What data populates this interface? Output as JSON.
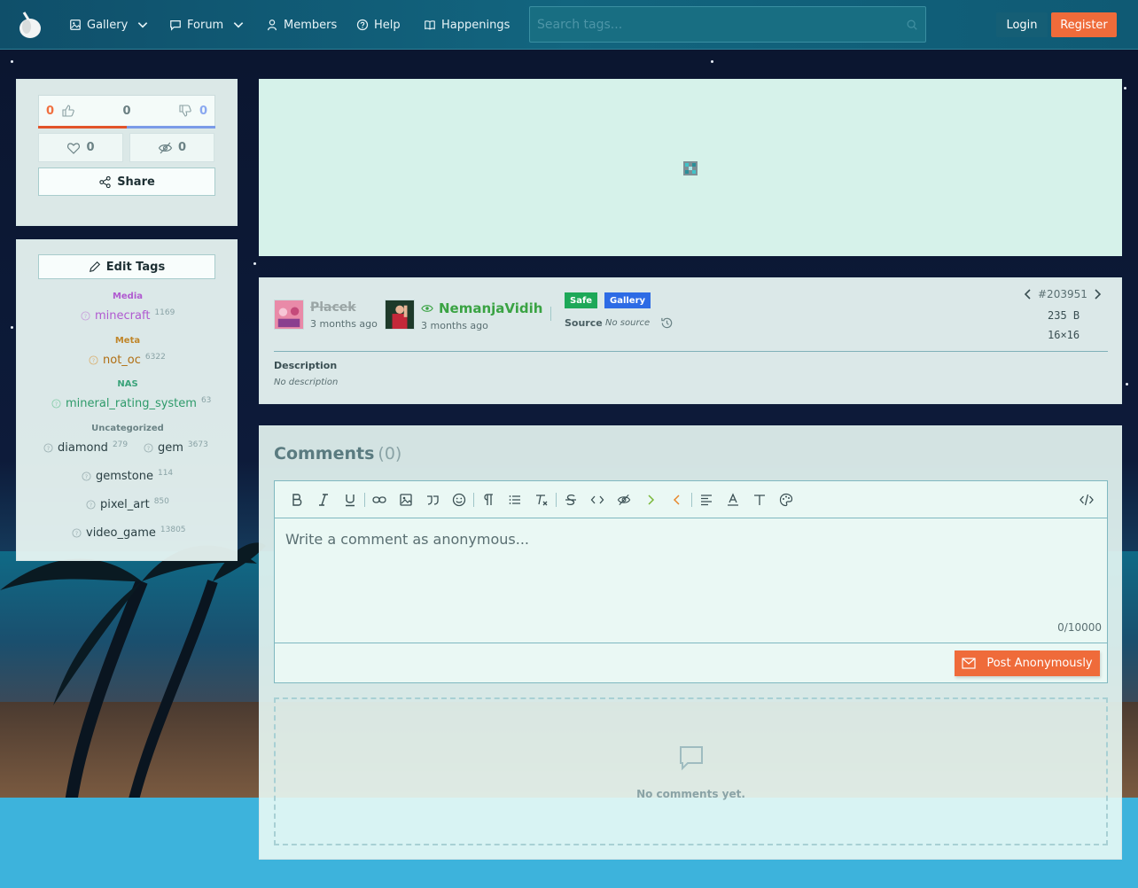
{
  "nav": {
    "items": [
      {
        "label": "Gallery",
        "icon": "image-icon",
        "dropdown": true
      },
      {
        "label": "Forum",
        "icon": "chat-icon",
        "dropdown": true
      },
      {
        "label": "Members",
        "icon": "user-icon",
        "dropdown": false
      },
      {
        "label": "Help",
        "icon": "help-icon",
        "dropdown": false
      },
      {
        "label": "Happenings",
        "icon": "book-icon",
        "dropdown": false
      }
    ],
    "search_placeholder": "Search tags...",
    "login_label": "Login",
    "register_label": "Register"
  },
  "votes": {
    "up": "0",
    "score": "0",
    "down": "0",
    "favorites": "0",
    "hides": "0",
    "share_label": "Share"
  },
  "tags": {
    "edit_label": "Edit Tags",
    "categories": [
      {
        "name": "Media",
        "color": "#b05ad0",
        "items": [
          {
            "name": "minecraft",
            "count": "1169"
          }
        ]
      },
      {
        "name": "Meta",
        "color": "#c0862a",
        "items": [
          {
            "name": "not_oc",
            "count": "6322"
          }
        ]
      },
      {
        "name": "NAS",
        "color": "#3aa37a",
        "items": [
          {
            "name": "mineral_rating_system",
            "count": "63"
          }
        ]
      },
      {
        "name": "Uncategorized",
        "color": "#6a8285",
        "items": [
          {
            "name": "diamond",
            "count": "279"
          },
          {
            "name": "gem",
            "count": "3673"
          },
          {
            "name": "gemstone",
            "count": "114"
          },
          {
            "name": "pixel_art",
            "count": "850"
          },
          {
            "name": "video_game",
            "count": "13805"
          }
        ]
      }
    ]
  },
  "info": {
    "uploader_name": "Placek",
    "uploader_time": "3 months ago",
    "approver_name": "NemanjaVidih",
    "approver_time": "3 months ago",
    "rating_badge": "Safe",
    "gallery_badge": "Gallery",
    "source_label": "Source",
    "source_value": "No source",
    "post_id": "#203951",
    "size": "235 B",
    "dimensions": "16×16",
    "description_label": "Description",
    "description_value": "No description"
  },
  "comments": {
    "title": "Comments",
    "count": "(0)",
    "placeholder": "Write a comment as anonymous...",
    "char_count": "0/10000",
    "post_label": "Post Anonymously",
    "empty_text": "No comments yet."
  },
  "colors": {
    "accent": "#ef6b3a",
    "nav_bg": "#12657f",
    "safe": "#1da858",
    "gallery": "#2d6be5",
    "approver": "#3aa343"
  }
}
